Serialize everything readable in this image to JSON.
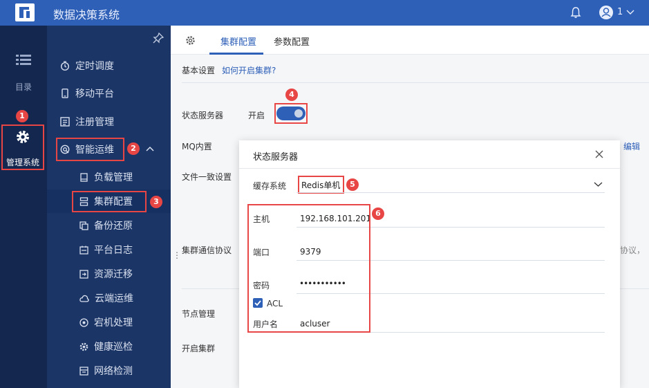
{
  "header": {
    "app_title": "数据决策系统",
    "user_count": "1"
  },
  "rail": {
    "directory_label": "目录",
    "admin_label": "管理系统"
  },
  "menu": {
    "items": [
      {
        "label": "定时调度",
        "icon": "timer-icon"
      },
      {
        "label": "移动平台",
        "icon": "mobile-icon"
      },
      {
        "label": "注册管理",
        "icon": "register-icon"
      },
      {
        "label": "智能运维",
        "icon": "ops-icon",
        "expanded": true
      }
    ],
    "sub_items": [
      {
        "label": "负载管理",
        "icon": "load-icon"
      },
      {
        "label": "集群配置",
        "icon": "cluster-icon",
        "active": true
      },
      {
        "label": "备份还原",
        "icon": "backup-icon"
      },
      {
        "label": "平台日志",
        "icon": "log-icon"
      },
      {
        "label": "资源迁移",
        "icon": "migrate-icon"
      },
      {
        "label": "云端运维",
        "icon": "cloud-icon"
      },
      {
        "label": "宕机处理",
        "icon": "crash-icon"
      },
      {
        "label": "健康巡检",
        "icon": "health-icon"
      },
      {
        "label": "网络检测",
        "icon": "network-icon"
      }
    ]
  },
  "tabs": {
    "items": [
      "集群配置",
      "参数配置"
    ],
    "active": "集群配置"
  },
  "panel": {
    "basic_settings": "基本设置",
    "how_to_link": "如何开启集群?",
    "state_server_label": "状态服务器",
    "state_server_value": "开启",
    "toggle_on": true,
    "mq_label": "MQ内置",
    "edit_link": "编辑",
    "file_consistency_label": "文件一致设置",
    "protocol_label": "集群通信协议",
    "protocol_partial": "协议，",
    "node_mgmt_label": "节点管理",
    "enable_cluster_label": "开启集群"
  },
  "modal": {
    "title": "状态服务器",
    "cache_label": "缓存系统",
    "cache_value": "Redis单机",
    "host_label": "主机",
    "host_value": "192.168.101.201",
    "port_label": "端口",
    "port_value": "9379",
    "password_label": "密码",
    "password_value": "•••••••••••",
    "acl_label": "ACL",
    "acl_checked": true,
    "username_label": "用户名",
    "username_value": "acluser"
  },
  "badges": [
    "1",
    "2",
    "3",
    "4",
    "5",
    "6"
  ],
  "colors": {
    "primary": "#2e60b8",
    "highlight": "#e84545",
    "rail_bg": "#14274f",
    "submenu_bg": "#1b3566"
  }
}
